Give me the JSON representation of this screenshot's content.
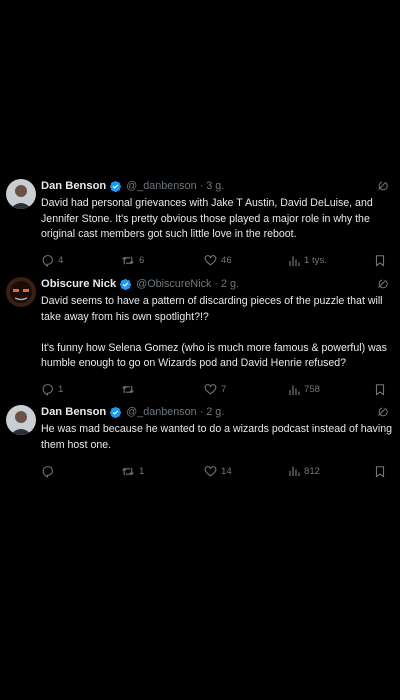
{
  "tweets": [
    {
      "display_name": "Dan Benson",
      "handle": "@_danbenson",
      "time": "3 g.",
      "text": "David had personal grievances with Jake T Austin, David DeLuise, and Jennifer Stone. It's pretty obvious those played a major role in why the original cast members got such little love in the reboot.",
      "replies": "4",
      "reposts": "6",
      "likes": "46",
      "views": "1 tys."
    },
    {
      "display_name": "Obiscure Nick",
      "handle": "@ObiscureNick",
      "time": "2 g.",
      "text": "David seems to have a pattern of discarding pieces of the puzzle that will take away from his own spotlight?!?\n\nIt's funny how Selena Gomez (who is much more famous & powerful) was humble enough to go on Wizards pod and David Henrie refused?",
      "replies": "1",
      "reposts": "",
      "likes": "7",
      "views": "758"
    },
    {
      "display_name": "Dan Benson",
      "handle": "@_danbenson",
      "time": "2 g.",
      "text": "He was mad because he wanted to do a wizards podcast instead of having them host one.",
      "replies": "",
      "reposts": "1",
      "likes": "14",
      "views": "812"
    }
  ],
  "icons": {
    "reply": "reply-icon",
    "retweet": "retweet-icon",
    "like": "heart-icon",
    "views": "views-icon",
    "bookmark": "bookmark-icon",
    "verified": "verified-badge-icon",
    "grok": "grok-icon"
  },
  "colors": {
    "background": "#000000",
    "text": "#e7e9ea",
    "secondary": "#6e767d",
    "verified": "#1d9bf0"
  }
}
